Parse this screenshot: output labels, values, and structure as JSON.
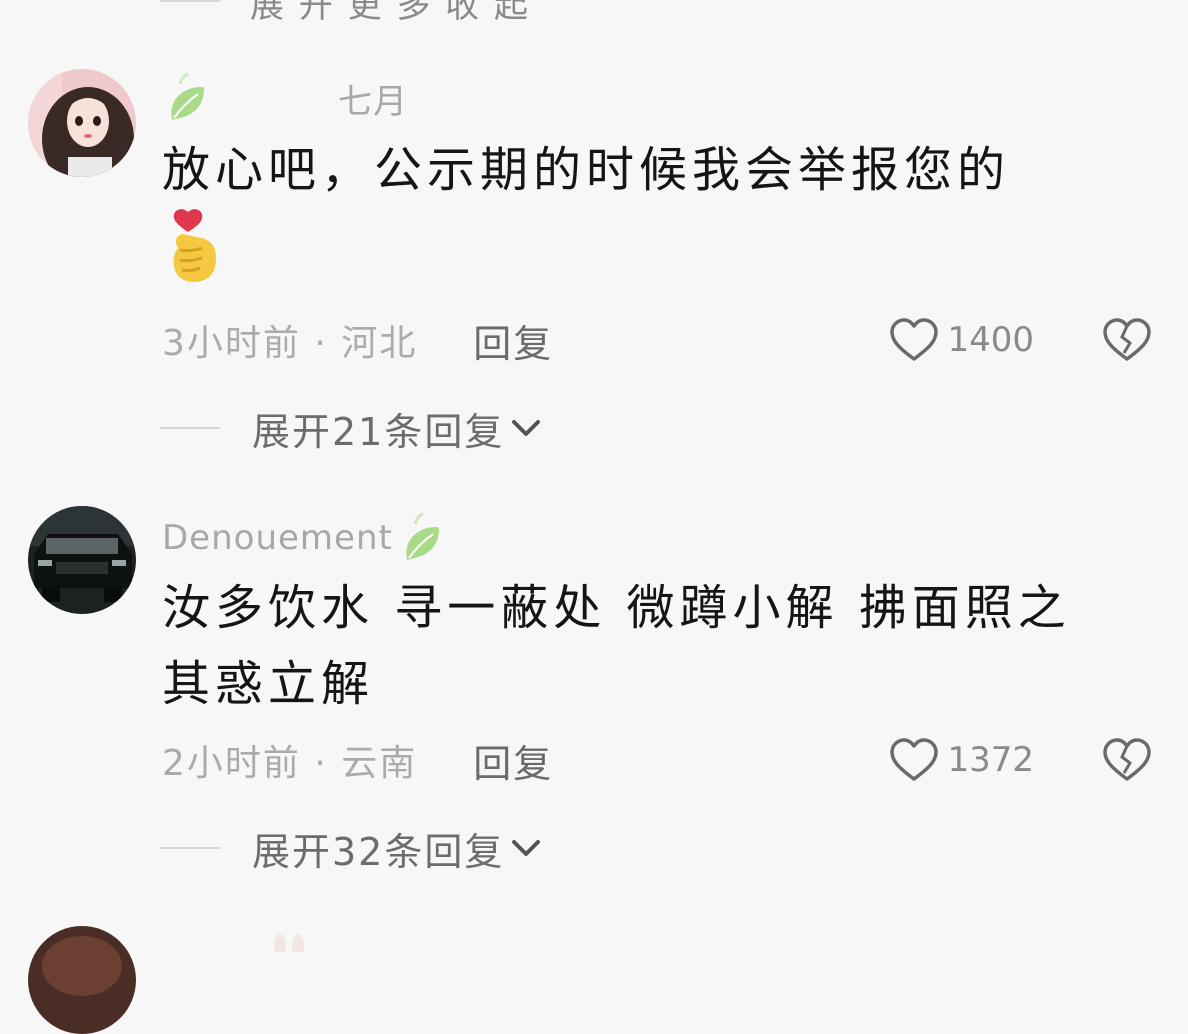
{
  "top_clip": "展 开 更 多        收 起",
  "comments": [
    {
      "username": "七月",
      "text": "放心吧，公示期的时候我会举报您的",
      "emoji": "🫰",
      "meta": "3小时前 · 河北",
      "reply_label": "回复",
      "likes": "1400",
      "expand_label": "展开21条回复"
    },
    {
      "username": "Denouement",
      "text": "汝多饮水 寻一蔽处 微蹲小解 拂面照之 其惑立解",
      "meta": "2小时前 · 云南",
      "reply_label": "回复",
      "likes": "1372",
      "expand_label": "展开32条回复"
    }
  ],
  "icons": {
    "leaf": "leaf-badge-icon",
    "heart": "heart-outline-icon",
    "dislike": "broken-heart-icon",
    "chevron": "chevron-down-icon",
    "bunny": "bunny-ears-icon"
  },
  "colors": {
    "background": "#f7f7f7",
    "leaf_green": "#8fcf6a",
    "meta_gray": "#ababab"
  }
}
